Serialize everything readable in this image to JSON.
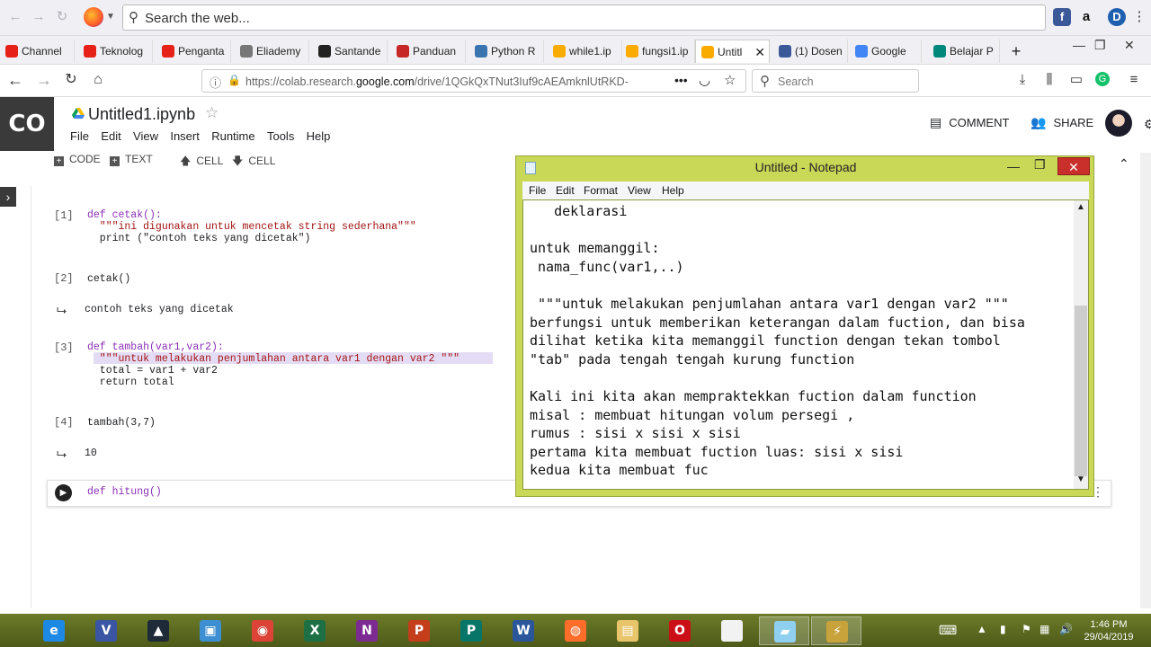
{
  "browser": {
    "search_placeholder": "Search the web...",
    "url_prefix": "https://colab.research.",
    "url_domain": "google.com",
    "url_suffix": "/drive/1QGkQxTNut3Iuf9cAEAmknlUtRKD-",
    "search_box": "Search",
    "tabs": [
      {
        "label": "Channel",
        "color": "#e62117"
      },
      {
        "label": "Teknolog",
        "color": "#e62117"
      },
      {
        "label": "Penganta",
        "color": "#e62117"
      },
      {
        "label": "Eliademy",
        "color": "#777777"
      },
      {
        "label": "Santande",
        "color": "#222222"
      },
      {
        "label": "Panduan",
        "color": "#c62828"
      },
      {
        "label": "Python R",
        "color": "#3a75b0"
      },
      {
        "label": "while1.ip",
        "color": "#f9ab00"
      },
      {
        "label": "fungsi1.ip",
        "color": "#f9ab00"
      },
      {
        "label": "Untitl",
        "color": "#f9ab00"
      },
      {
        "label": "(1) Dosen",
        "color": "#3b5998"
      },
      {
        "label": "Google",
        "color": "#4285f4"
      },
      {
        "label": "Belajar P",
        "color": "#00897b"
      }
    ]
  },
  "colab": {
    "logo": "CO",
    "title": "Untitled1.ipynb",
    "menu": [
      "File",
      "Edit",
      "View",
      "Insert",
      "Runtime",
      "Tools",
      "Help"
    ],
    "toolbar": {
      "code": "CODE",
      "text": "TEXT",
      "cell_up": "CELL",
      "cell_down": "CELL"
    },
    "comment": "COMMENT",
    "share": "SHARE",
    "cells": [
      {
        "prompt": "[1]",
        "lines": [
          "def cetak():",
          "  \"\"\"ini digunakan untuk mencetak string sederhana\"\"\"",
          "  print (\"contoh teks yang dicetak\")"
        ]
      },
      {
        "prompt": "[2]",
        "lines": [
          "cetak()"
        ],
        "output": "contoh teks yang dicetak"
      },
      {
        "prompt": "[3]",
        "lines": [
          "def tambah(var1,var2):",
          "  \"\"\"untuk melakukan penjumlahan antara var1 dengan var2 \"\"\"",
          "  total = var1 + var2",
          "  return total"
        ]
      },
      {
        "prompt": "[4]",
        "lines": [
          "tambah(3,7)"
        ],
        "output": "10"
      },
      {
        "prompt": "",
        "lines": [
          "def hitung()"
        ]
      }
    ]
  },
  "notepad": {
    "title": "Untitled - Notepad",
    "menu": [
      "File",
      "Edit",
      "Format",
      "View",
      "Help"
    ],
    "text": "   deklarasi\n\nuntuk memanggil:\n nama_func(var1,..)\n\n \"\"\"untuk melakukan penjumlahan antara var1 dengan var2 \"\"\"\nberfungsi untuk memberikan keterangan dalam fuction, dan bisa\ndilihat ketika kita memanggil function dengan tekan tombol\n\"tab\" pada tengah tengah kurung function\n\nKali ini kita akan mempraktekkan fuction dalam function\nmisal : membuat hitungan volum persegi ,\nrumus : sisi x sisi x sisi\npertama kita membuat fuction luas: sisi x sisi\nkedua kita membuat fuc"
  },
  "taskbar": {
    "apps": [
      {
        "name": "ie",
        "glyph": "e",
        "color": "#1e88e5"
      },
      {
        "name": "visio",
        "glyph": "V",
        "color": "#3955a3"
      },
      {
        "name": "bird",
        "glyph": "▲",
        "color": "#1f2a38"
      },
      {
        "name": "app-window",
        "glyph": "▣",
        "color": "#3d8fd1"
      },
      {
        "name": "chrome",
        "glyph": "◉",
        "color": "#db4437"
      },
      {
        "name": "excel",
        "glyph": "X",
        "color": "#1d7044"
      },
      {
        "name": "onenote",
        "glyph": "N",
        "color": "#7b2b91"
      },
      {
        "name": "powerpoint",
        "glyph": "P",
        "color": "#c43e1c"
      },
      {
        "name": "publisher",
        "glyph": "P",
        "color": "#077568"
      },
      {
        "name": "word",
        "glyph": "W",
        "color": "#2b579a"
      },
      {
        "name": "firefox",
        "glyph": "◍",
        "color": "#ff6d2a"
      },
      {
        "name": "explorer",
        "glyph": "▤",
        "color": "#e8c46a"
      },
      {
        "name": "opera",
        "glyph": "O",
        "color": "#cc0f16"
      },
      {
        "name": "blank-doc",
        "glyph": "",
        "color": "#f2f2f2"
      },
      {
        "name": "notepad",
        "glyph": "▰",
        "color": "#8fd0f0"
      },
      {
        "name": "winamp",
        "glyph": "⚡",
        "color": "#c8a23a"
      }
    ],
    "time": "1:46 PM",
    "date": "29/04/2019"
  }
}
